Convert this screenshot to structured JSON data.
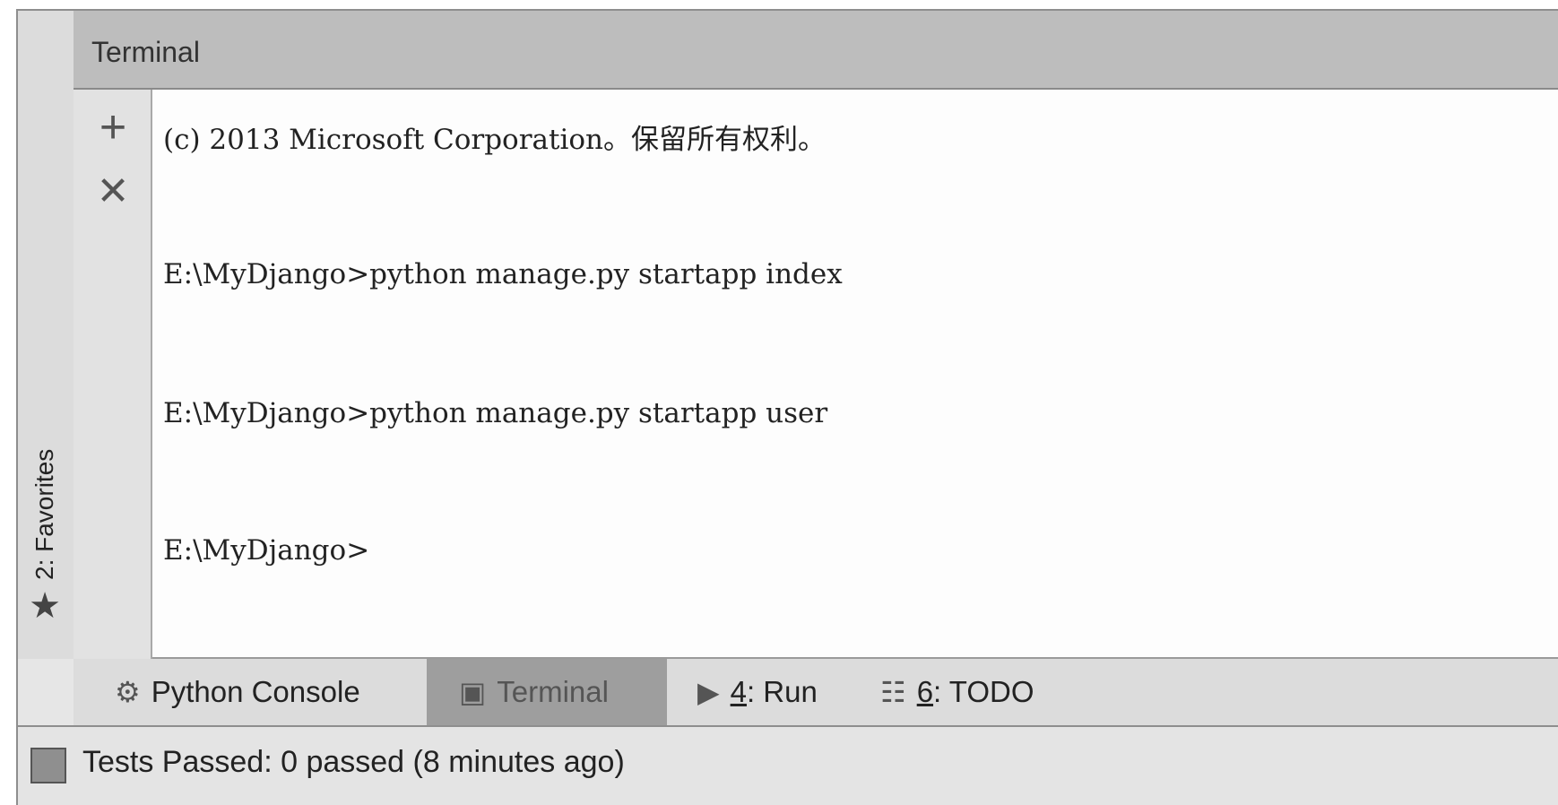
{
  "panel": {
    "title": "Terminal"
  },
  "left_sidebar": {
    "favorites_label": "2: Favorites",
    "favorites_icon": "star-icon"
  },
  "terminal_toolbar": {
    "new_session_icon": "plus-icon",
    "close_session_icon": "close-icon"
  },
  "terminal": {
    "lines": [
      "(c) 2013 Microsoft Corporation。保留所有权利。",
      "E:\\MyDjango>python manage.py startapp index",
      "E:\\MyDjango>python manage.py startapp user",
      "E:\\MyDjango>"
    ]
  },
  "tool_tabs": [
    {
      "icon": "python-console-icon",
      "label": "Python Console",
      "active": false
    },
    {
      "icon": "terminal-icon",
      "label": "Terminal",
      "active": true
    },
    {
      "icon": "run-icon",
      "mnemonic": "4",
      "rest": ": Run",
      "active": false
    },
    {
      "icon": "todo-icon",
      "mnemonic": "6",
      "rest": ": TODO",
      "active": false
    }
  ],
  "status_bar": {
    "text": "Tests Passed: 0 passed (8 minutes ago)"
  }
}
